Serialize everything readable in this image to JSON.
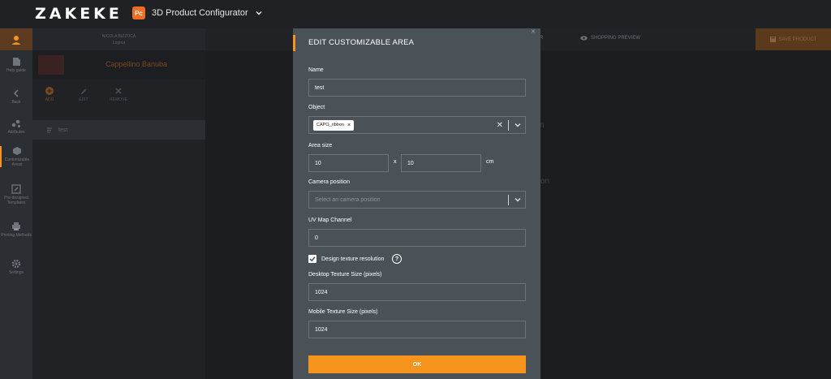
{
  "header": {
    "logo": "ZAKEKE",
    "app_badge": "Pc",
    "app_name": "3D Product Configurator"
  },
  "nav": {
    "items": [
      {
        "label": "Help guide"
      },
      {
        "label": "Back"
      },
      {
        "label": "Attributes"
      },
      {
        "label": "Customizable Areas"
      },
      {
        "label": "Pre-designed Templates"
      },
      {
        "label": "Printing Methods"
      },
      {
        "label": "Settings"
      }
    ]
  },
  "panel": {
    "user_name": "NICOLA BIZZOCA",
    "logout": "Logout",
    "product_name": "Cappellino Banuba",
    "tools": {
      "add": "ADD",
      "edit": "EDIT",
      "remove": "REMOVE"
    },
    "area_item": "test"
  },
  "main": {
    "tab_shopping_preview": "SHOPPING PREVIEW",
    "tab_left": "R",
    "save_label": "SAVE PRODUCT",
    "frag1": "n",
    "frag2": "on"
  },
  "modal": {
    "title": "EDIT CUSTOMIZABLE AREA",
    "name_label": "Name",
    "name_value": "test",
    "object_label": "Object",
    "object_chip": "CAPO_ribbon",
    "area_size_label": "Area size",
    "width_value": "10",
    "height_value": "10",
    "size_sep": "x",
    "unit": "cm",
    "camera_label": "Camera position",
    "camera_placeholder": "Select an camera position",
    "uv_label": "UV Map Channel",
    "uv_value": "0",
    "design_res_label": "Design texture resolution",
    "help_glyph": "?",
    "desktop_label": "Desktop Texture Size (pixels)",
    "desktop_value": "1024",
    "mobile_label": "Mobile Texture Size (pixels)",
    "mobile_value": "1024",
    "ok_label": "OK",
    "design_res_checked": true
  },
  "colors": {
    "accent": "#f7941d",
    "modal_bg": "#4a5157",
    "topbar": "#1f2124"
  }
}
